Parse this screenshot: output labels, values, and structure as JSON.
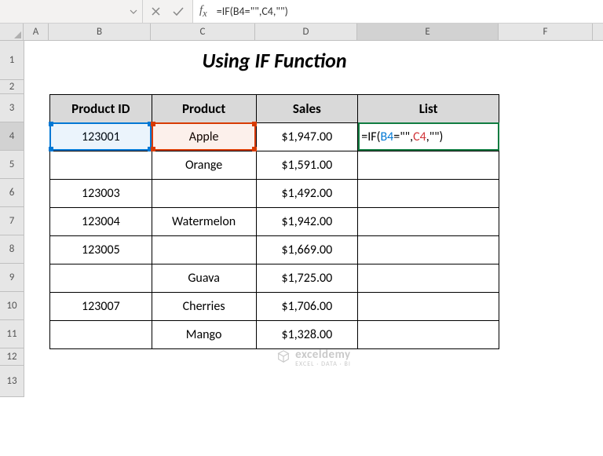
{
  "formula_bar": {
    "formula": "=IF(B4=\"\",C4,\"\")"
  },
  "columns": [
    "A",
    "B",
    "C",
    "D",
    "E",
    "F"
  ],
  "rows": [
    "1",
    "2",
    "3",
    "4",
    "5",
    "6",
    "7",
    "8",
    "9",
    "10",
    "11",
    "12",
    "13"
  ],
  "title": "Using IF Function",
  "headers": {
    "b": "Product ID",
    "c": "Product",
    "d": "Sales",
    "e": "List"
  },
  "table": [
    {
      "id": "123001",
      "product": "Apple",
      "sales": "$1,947.00"
    },
    {
      "id": "",
      "product": "Orange",
      "sales": "$1,591.00"
    },
    {
      "id": "123003",
      "product": "",
      "sales": "$1,492.00"
    },
    {
      "id": "123004",
      "product": "Watermelon",
      "sales": "$1,942.00"
    },
    {
      "id": "123005",
      "product": "",
      "sales": "$1,669.00"
    },
    {
      "id": "",
      "product": "Guava",
      "sales": "$1,725.00"
    },
    {
      "id": "123007",
      "product": "Cherries",
      "sales": "$1,706.00"
    },
    {
      "id": "",
      "product": "Mango",
      "sales": "$1,328.00"
    }
  ],
  "cell_formula": {
    "prefix": "=IF(",
    "ref1": "B4",
    "mid1": "=\"\",",
    "ref2": "C4",
    "suffix": ",\"\")"
  },
  "watermark": {
    "brand": "exceldemy",
    "tagline": "EXCEL · DATA · BI"
  }
}
